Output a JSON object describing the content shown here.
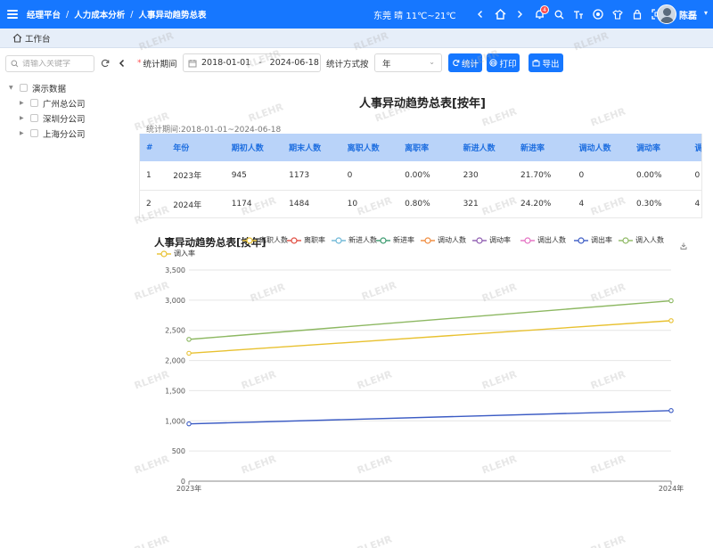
{
  "topbar": {
    "breadcrumb": [
      "经理平台",
      "人力成本分析",
      "人事异动趋势总表"
    ],
    "weather": "东莞 晴 11℃~21℃",
    "notification_count": "4",
    "user_name": "陈磊"
  },
  "tabs": {
    "home_label": "工作台"
  },
  "sidebar": {
    "search_placeholder": "请输入关键字",
    "tree": [
      {
        "label": "演示数据",
        "level": 0
      },
      {
        "label": "广州总公司",
        "level": 1
      },
      {
        "label": "深圳分公司",
        "level": 1
      },
      {
        "label": "上海分公司",
        "level": 1
      }
    ]
  },
  "filter": {
    "period_label": "统计期间",
    "date_start": "2018-01-01",
    "date_sep": "-",
    "date_end": "2024-06-18",
    "method_label": "统计方式按",
    "method_value": "年",
    "btn_stat": "统计",
    "btn_print": "打印",
    "btn_export": "导出"
  },
  "report": {
    "title": "人事异动趋势总表[按年]",
    "period_text": "统计期间:2018-01-01~2024-06-18",
    "columns": [
      "#",
      "年份",
      "期初人数",
      "期末人数",
      "离职人数",
      "离职率",
      "新进人数",
      "新进率",
      "调动人数",
      "调动率",
      "调出"
    ],
    "rows": [
      [
        "1",
        "2023年",
        "945",
        "1173",
        "0",
        "0.00%",
        "230",
        "21.70%",
        "0",
        "0.00%",
        "0"
      ],
      [
        "2",
        "2024年",
        "1174",
        "1484",
        "10",
        "0.80%",
        "321",
        "24.20%",
        "4",
        "0.30%",
        "4"
      ]
    ]
  },
  "colors": {
    "primary": "#1677ff",
    "header_bg": "#b9d3f9",
    "tab_bg": "#e6eef9"
  },
  "watermark": "RLEHR",
  "chart_data": {
    "type": "line",
    "title": "人事异动趋势总表[按年]",
    "categories": [
      "2023年",
      "2024年"
    ],
    "ylim": [
      0,
      3500
    ],
    "yticks": [
      0,
      500,
      1000,
      1500,
      2000,
      2500,
      3000,
      3500
    ],
    "ytick_labels": [
      "0",
      "500",
      "1,000",
      "1,500",
      "2,000",
      "2,500",
      "3,000",
      "3,500"
    ],
    "grid": true,
    "legend_position": "top",
    "series": [
      {
        "name": "离职人数",
        "color": "#e8c130",
        "values": [
          null,
          null
        ]
      },
      {
        "name": "离职率",
        "color": "#e04b3f",
        "values": [
          null,
          null
        ]
      },
      {
        "name": "新进人数",
        "color": "#6bb6d6",
        "values": [
          null,
          null
        ]
      },
      {
        "name": "新进率",
        "color": "#3a9a6e",
        "values": [
          null,
          null
        ]
      },
      {
        "name": "调动人数",
        "color": "#f08a3c",
        "values": [
          null,
          null
        ]
      },
      {
        "name": "调动率",
        "color": "#8e5bb0",
        "values": [
          null,
          null
        ]
      },
      {
        "name": "调出人数",
        "color": "#e36fc1",
        "values": [
          null,
          null
        ]
      },
      {
        "name": "调出率",
        "color": "#3b5bc4",
        "values": [
          950,
          1170
        ]
      },
      {
        "name": "调入人数",
        "color": "#8db862",
        "values": [
          2350,
          2990
        ]
      },
      {
        "name": "调入率",
        "color": "#e8c130",
        "values": [
          2120,
          2660
        ]
      }
    ]
  }
}
